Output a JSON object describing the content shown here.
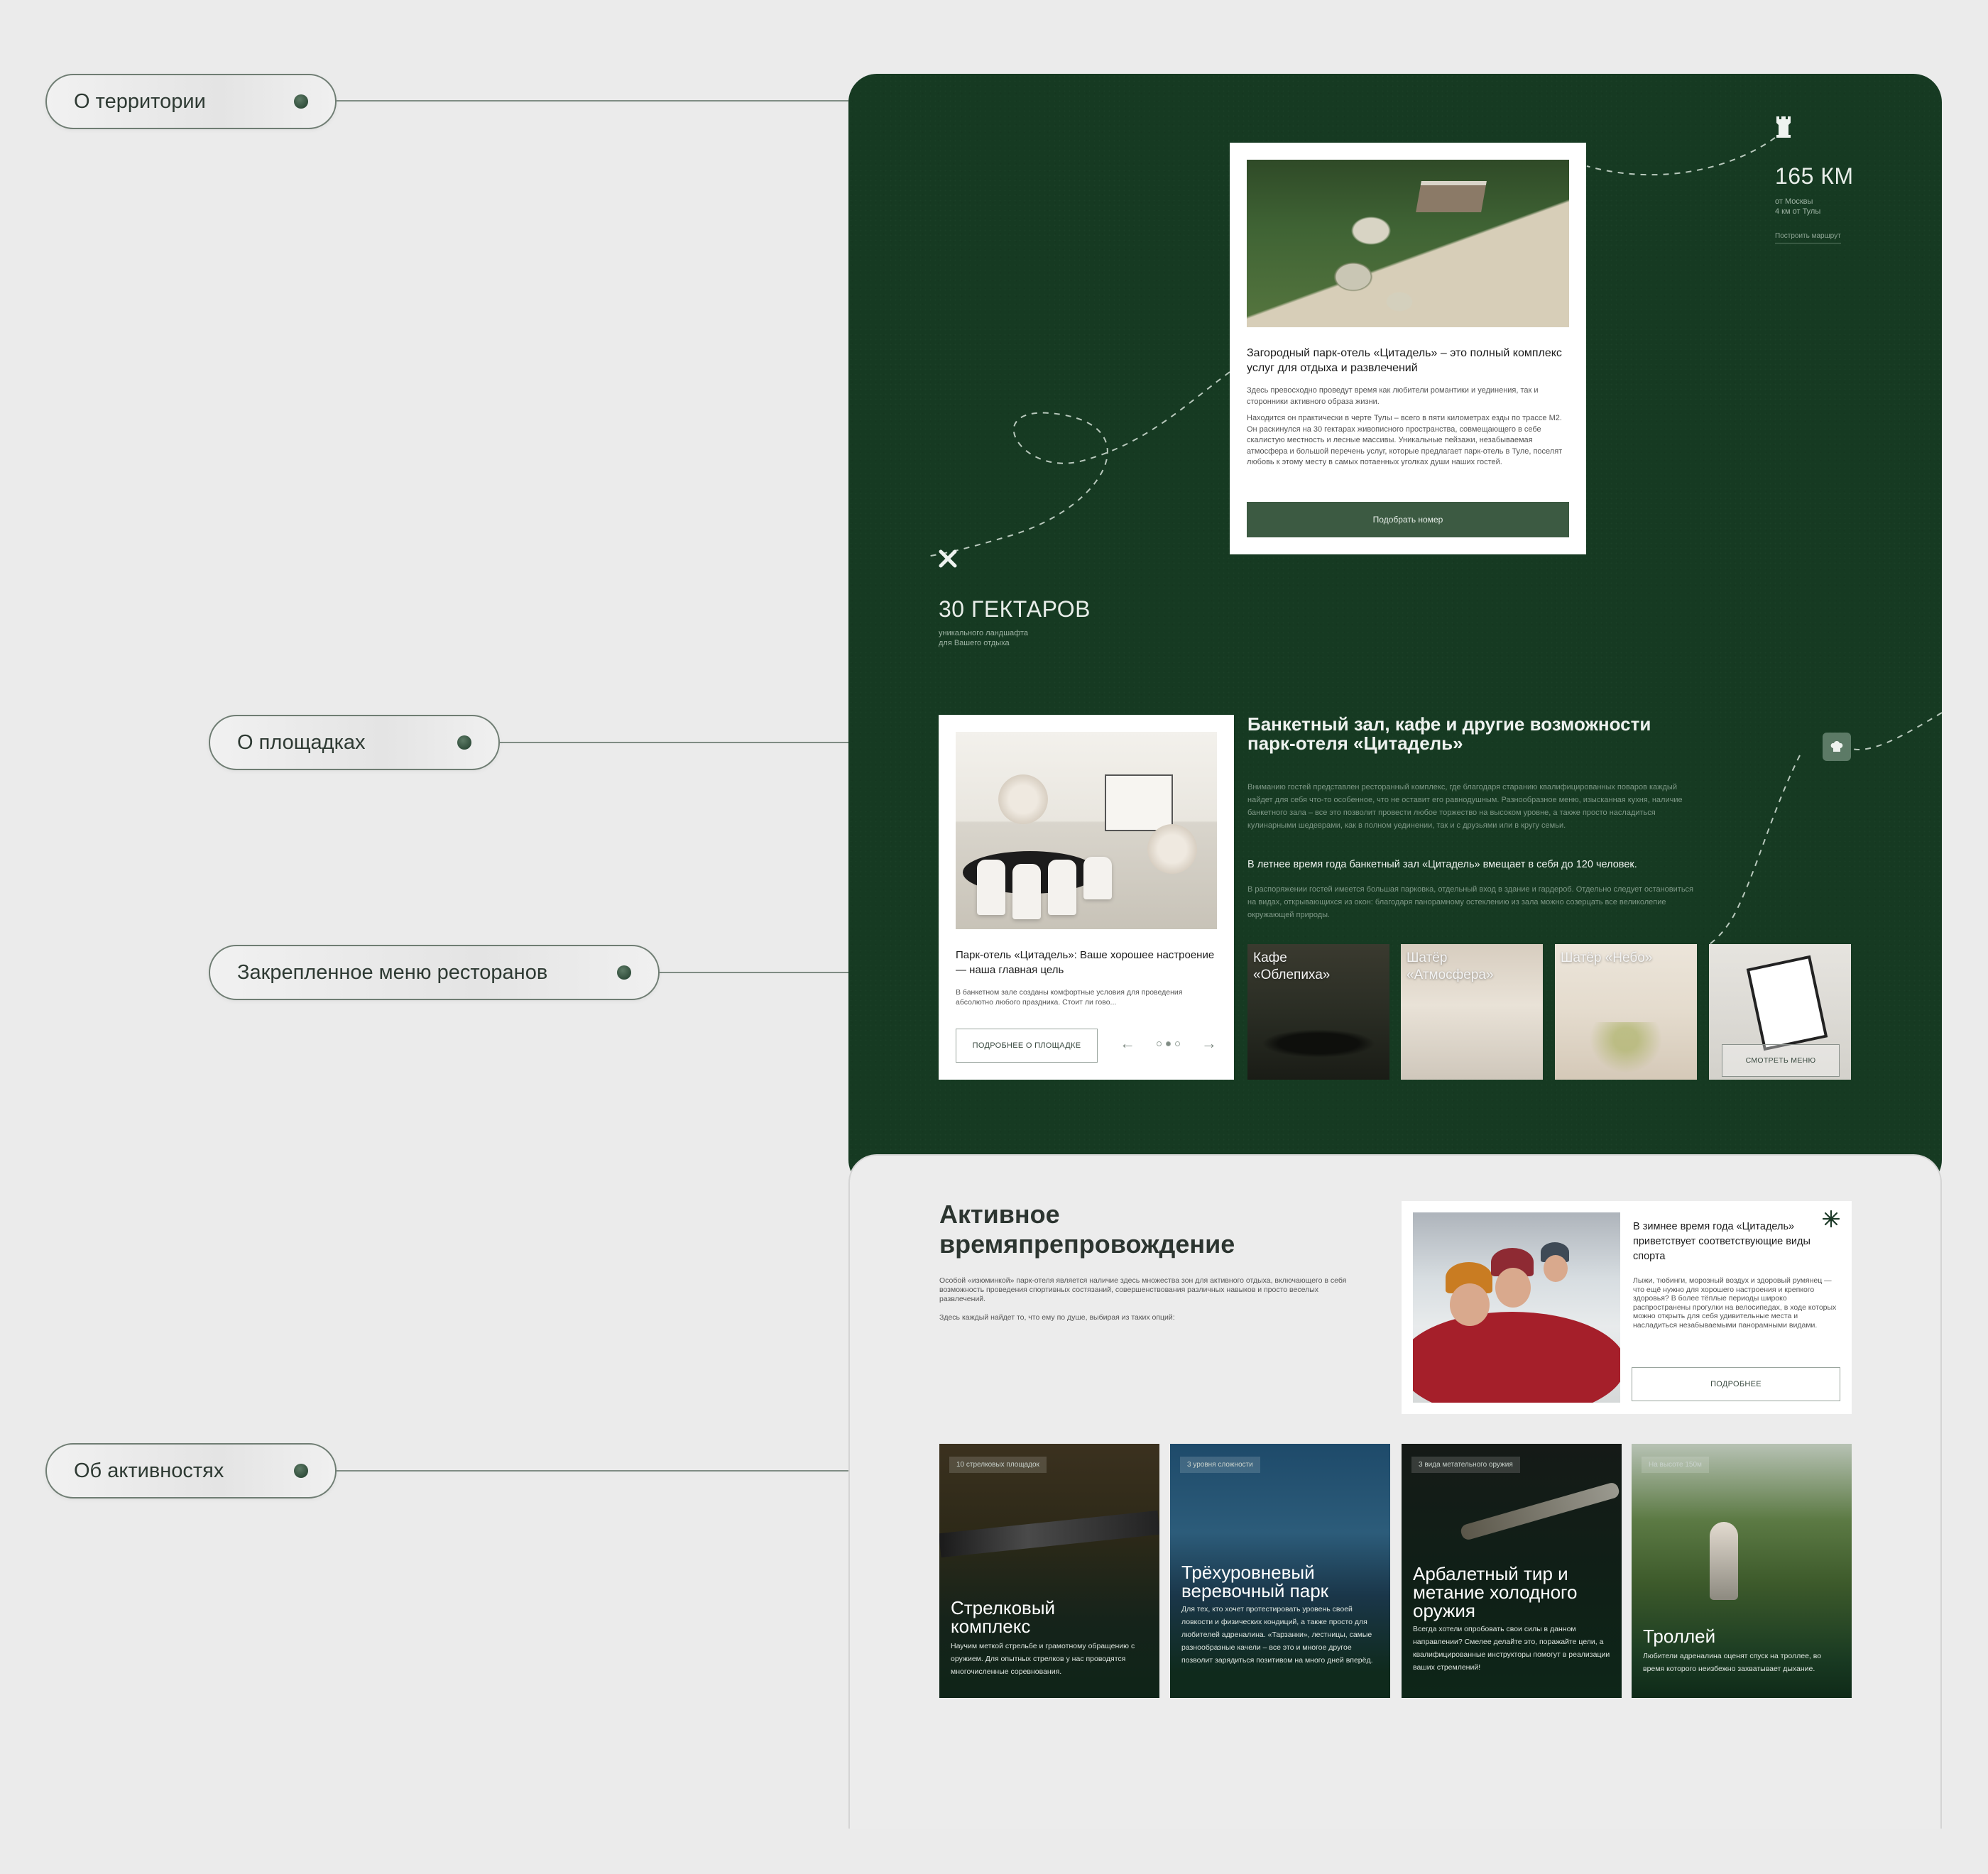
{
  "annotations": {
    "territory": "О территории",
    "venues": "О площадках",
    "menu": "Закрепленное меню ресторанов",
    "activities": "Об активностях"
  },
  "intro": {
    "title": "Загородный парк-отель «Цитадель» – это полный комплекс услуг для отдыха и развлечений",
    "p1": "Здесь превосходно проведут время как любители романтики и уединения, так и сторонники активного образа жизни.",
    "p2": "Находится он практически в черте Тулы – всего в пяти километрах езды по трассе М2. Он раскинулся на 30 гектарах живописного пространства, совмещающего в себе скалистую местность и лесные массивы. Уникальные пейзажи, незабываемая атмосфера и большой перечень услуг, которые предлагает парк-отель в Туле, поселят любовь к этому месту в самых потаенных уголках души наших гостей.",
    "button": "Подобрать номер"
  },
  "distance": {
    "value": "165 КМ",
    "line1": "от Москвы",
    "line2": "4 км от Тулы",
    "link": "Построить маршрут"
  },
  "area": {
    "value": "30 ГЕКТАРОВ",
    "line1": "уникального ландшафта",
    "line2": "для Вашего отдыха"
  },
  "venue": {
    "title": "Парк-отель «Цитадель»: Ваше хорошее настроение — наша главная цель",
    "text": "В банкетном зале созданы комфортные условия для проведения абсолютно любого праздника. Стоит ли гово...",
    "button": "ПОДРОБНЕЕ О ПЛОЩАДКЕ",
    "prev": "←",
    "next": "→"
  },
  "banquet": {
    "title": "Банкетный зал, кафе и другие возможности парк-отеля «Цитадель»",
    "p1": "Вниманию гостей представлен ресторанный комплекс, где благодаря старанию квалифицированных поваров каждый найдет для себя что-то особенное, что не оставит его равнодушным. Разнообразное меню, изысканная кухня, наличие банкетного зала – все это позволит провести любое торжество на высоком уровне, а также просто насладиться кулинарными шедеврами, как в полном уединении, так и с друзьями или в кругу семьи.",
    "highlight": "В летнее время года банкетный зал «Цитадель» вмещает в себя до 120 человек.",
    "p2": "В распоряжении гостей имеется большая парковка, отдельный вход в здание и гардероб. Отдельно следует остановиться на видах, открывающихся из окон: благодаря панорамному остеклению из зала можно созерцать все великолепие окружающей природы."
  },
  "tiles": [
    {
      "label": "Кафе «Облепиха»"
    },
    {
      "label": "Шатёр «Атмосфера»"
    },
    {
      "label": "Шатёр «Небо»"
    },
    {
      "label": "",
      "button": "СМОТРЕТЬ МЕНЮ"
    }
  ],
  "active": {
    "title": "Активное времяпрепровождение",
    "p1": "Особой «изюминкой» парк-отеля является наличие здесь множества зон для активного отдыха, включающего в себя возможность проведения спортивных состязаний, совершенствования различных навыков и просто веселых развлечений.",
    "p2": "Здесь каждый найдет то, что ему по душе, выбирая из таких опций:"
  },
  "winter": {
    "title": "В зимнее время года «Цитадель» приветствует соответствующие виды спорта",
    "text": "Лыжи, тюбинги, морозный воздух и здоровый румянец — что ещё нужно для хорошего настроения и крепкого здоровья? В более тёплые периоды широко распространены прогулки на велосипедах, в ходе которых можно открыть для себя удивительные места и насладиться незабываемыми панорамными видами.",
    "button": "ПОДРОБНЕЕ"
  },
  "activities": [
    {
      "tag": "10 стрелковых площадок",
      "title": "Стрелковый комплекс",
      "text": "Научим меткой стрельбе и грамотному обращению с оружием. Для опытных стрелков у нас проводятся многочисленные соревнования."
    },
    {
      "tag": "3 уровня сложности",
      "title": "Трёхуровневый веревочный парк",
      "text": "Для тех, кто хочет протестировать уровень своей ловкости и физических кондиций, а также просто для любителей адреналина. «Тарзанки», лестницы, самые разнообразные качели – все это и многое другое позволит зарядиться позитивом на много дней вперёд."
    },
    {
      "tag": "3 вида метательного оружия",
      "title": "Арбалетный тир и метание холодного оружия",
      "text": "Всегда хотели опробовать свои силы в данном направлении? Смелее делайте это, поражайте цели, а квалифицированные инструкторы помогут в реализации ваших стремлений!"
    },
    {
      "tag": "На высоте 150м",
      "title": "Троллей",
      "text": "Любители адреналина оценят спуск на троллее, во время которого неизбежно захватывает дыхание."
    }
  ],
  "colors": {
    "dark_green": "#163a22",
    "button_green": "#3c5a42",
    "background": "#ebebeb"
  }
}
